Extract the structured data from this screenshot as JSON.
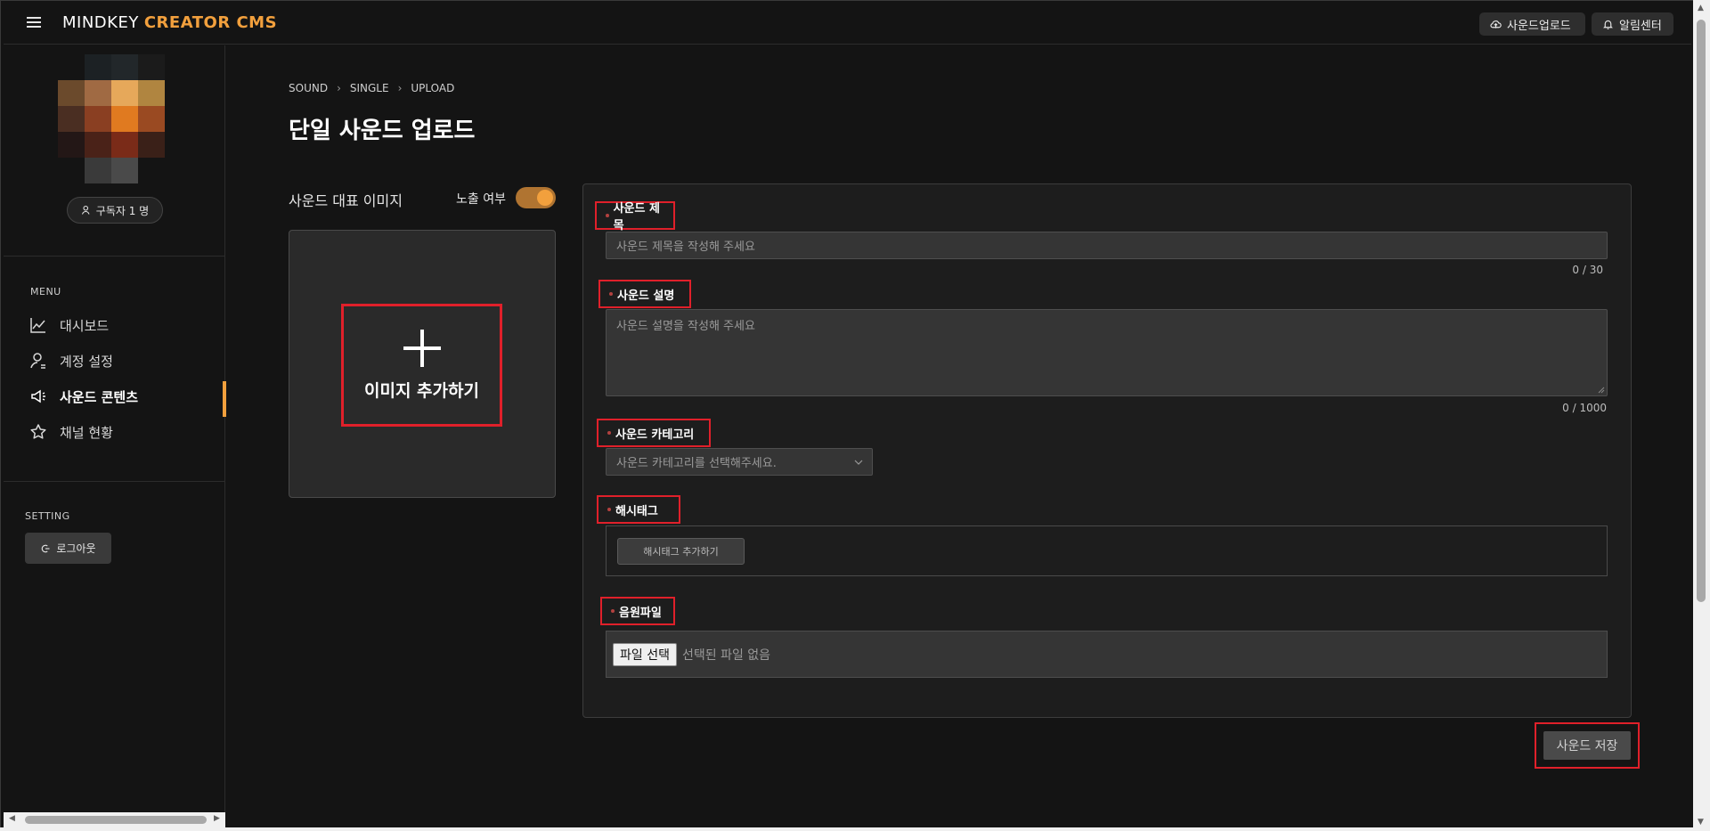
{
  "header": {
    "brand_primary": "MINDKEY",
    "brand_accent": "CREATOR CMS",
    "upload_button": "사운드업로드",
    "notification_button": "알림센터"
  },
  "sidebar": {
    "subscribers": "구독자 1 명",
    "menu_label": "MENU",
    "items": [
      {
        "label": "대시보드",
        "icon": "chart-line-icon"
      },
      {
        "label": "계정 설정",
        "icon": "user-settings-icon"
      },
      {
        "label": "사운드 콘텐츠",
        "icon": "speaker-icon",
        "active": true
      },
      {
        "label": "채널 현황",
        "icon": "star-icon"
      }
    ],
    "setting_label": "SETTING",
    "logout": "로그아웃"
  },
  "breadcrumb": [
    "SOUND",
    "SINGLE",
    "UPLOAD"
  ],
  "page_title": "단일 사운드 업로드",
  "image_section": {
    "label": "사운드 대표 이미지",
    "expose_label": "노출 여부",
    "expose_on": true,
    "add_image": "이미지 추가하기"
  },
  "form": {
    "title": {
      "label": "사운드 제목",
      "placeholder": "사운드 제목을 작성해 주세요",
      "counter": "0 / 30"
    },
    "description": {
      "label": "사운드 설명",
      "placeholder": "사운드 설명을 작성해 주세요",
      "counter": "0 / 1000"
    },
    "category": {
      "label": "사운드 카테고리",
      "placeholder": "사운드 카테고리를 선택해주세요."
    },
    "hashtag": {
      "label": "해시태그",
      "add_button": "해시태그 추가하기"
    },
    "file": {
      "label": "음원파일",
      "choose_button": "파일 선택",
      "status": "선택된 파일 없음"
    }
  },
  "save_button": "사운드 저장",
  "colors": {
    "accent": "#f2a03d",
    "highlight": "#e0202a",
    "background": "#141414"
  }
}
